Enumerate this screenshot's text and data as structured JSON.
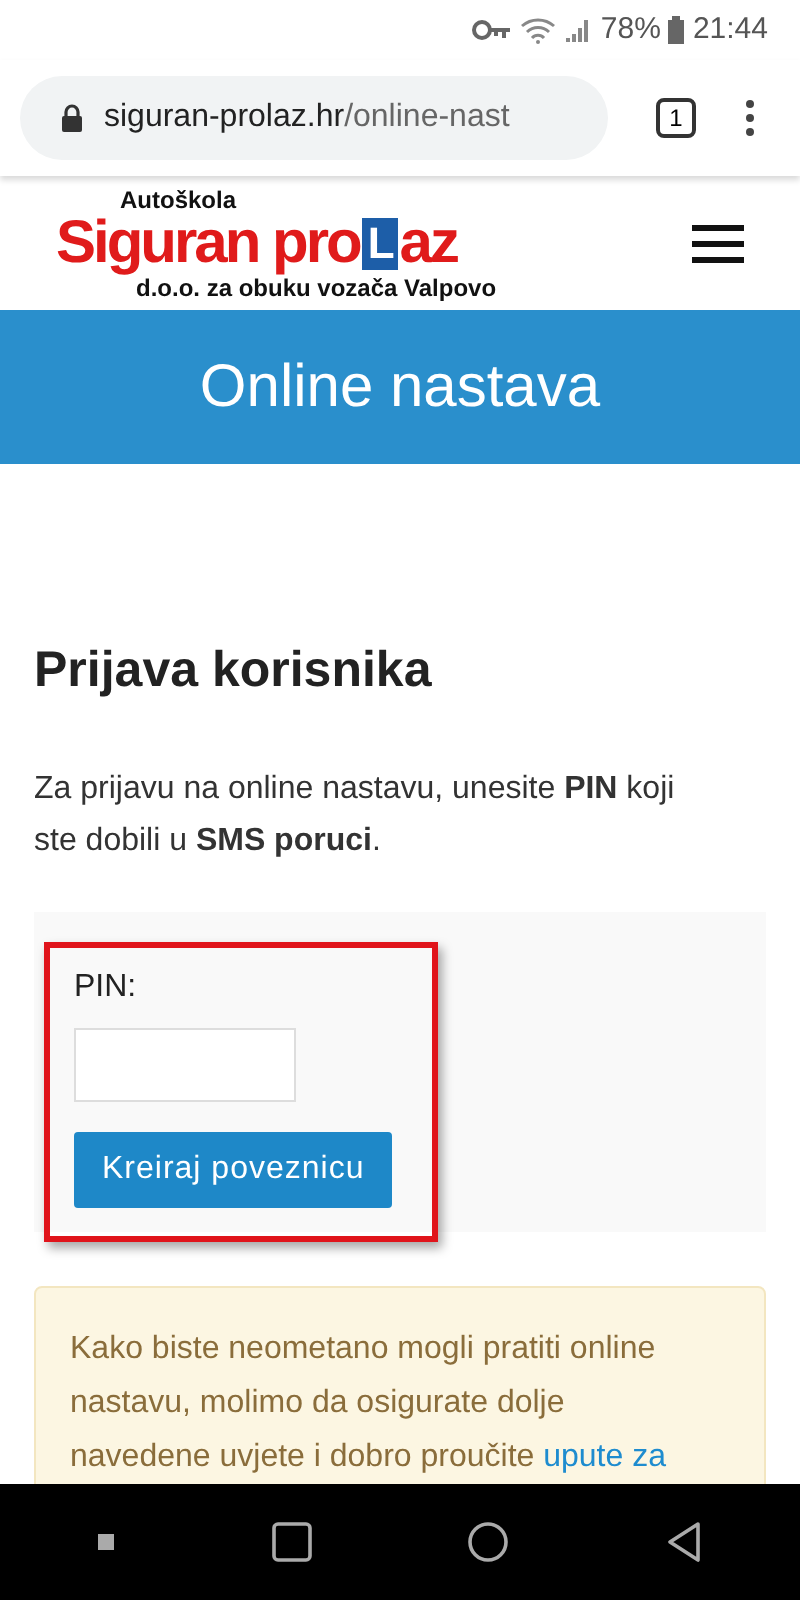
{
  "status_bar": {
    "battery": "78%",
    "time": "21:44"
  },
  "browser": {
    "url_host": "siguran-prolaz.hr",
    "url_path": "/online-nast",
    "tab_count": "1"
  },
  "logo": {
    "top": "Autoškola",
    "main": "Siguran pro",
    "letter": "L",
    "end": "az",
    "sub": "d.o.o. za obuku vozača Valpovo"
  },
  "banner": {
    "title": "Online nastava"
  },
  "login": {
    "heading": "Prijava korisnika",
    "intro": "Za prijavu na online nastavu, unesite **PIN** koji ste dobili u **SMS poruci**.",
    "form": {
      "highlighted": true,
      "label": "PIN:",
      "button": "Kreiraj poveznicu"
    }
  },
  "notice": {
    "text": "Kako biste neometano mogli pratiti online nastavu, molimo da osigurate dolje navedene uvjete i dobro proučite ",
    "link": "upute za"
  }
}
